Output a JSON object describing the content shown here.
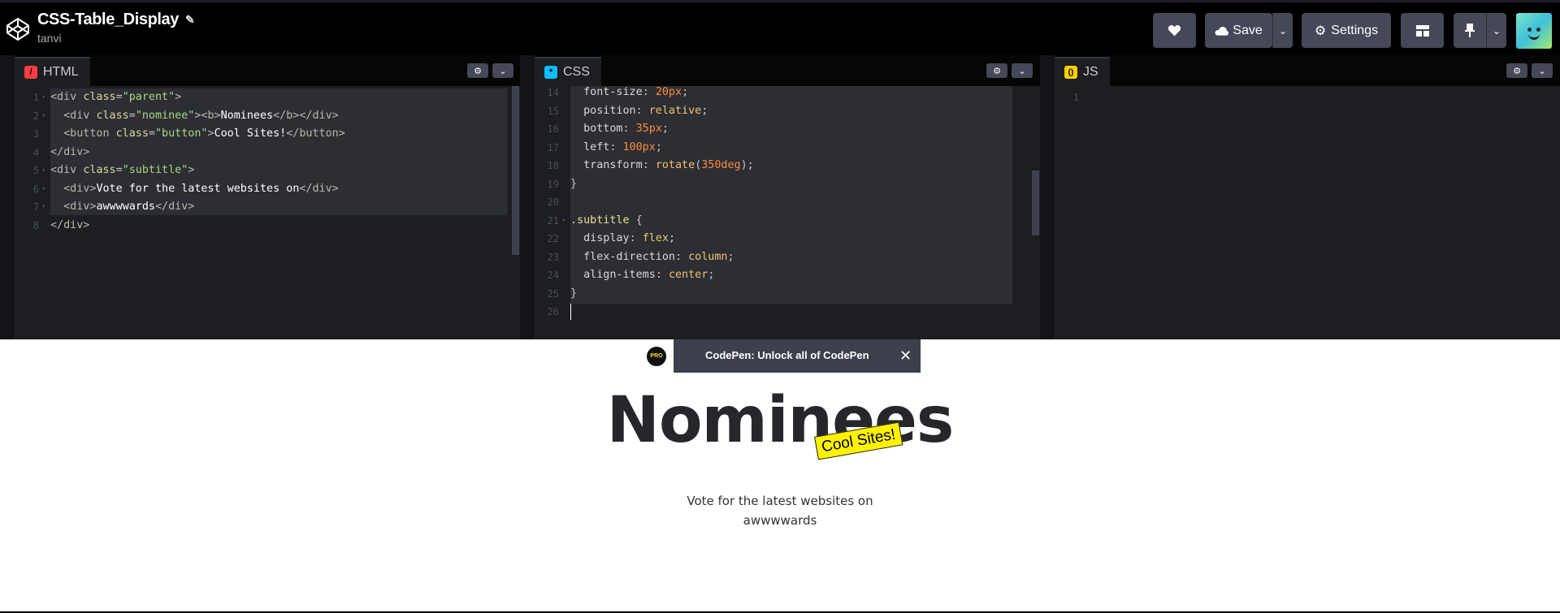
{
  "header": {
    "pen_title": "CSS-Table_Display",
    "author": "tanvi",
    "buttons": {
      "like_icon": "heart-icon",
      "save_label": "Save",
      "settings_label": "Settings",
      "layout_icon": "layout-grid-icon",
      "pin_icon": "pin-icon"
    }
  },
  "editors": {
    "html": {
      "label": "HTML",
      "badge": "/",
      "color": "#ff3c41"
    },
    "css": {
      "label": "CSS",
      "badge": "*",
      "color": "#0ebeff"
    },
    "js": {
      "label": "JS",
      "badge": "()",
      "color": "#fcd000"
    }
  },
  "html_code": {
    "line_numbers": [
      "1",
      "2",
      "3",
      "4",
      "5",
      "6",
      "7",
      "8"
    ]
  },
  "css_code": {
    "line_numbers": [
      "14",
      "15",
      "16",
      "17",
      "18",
      "19",
      "20",
      "21",
      "22",
      "23",
      "24",
      "25",
      "26"
    ]
  },
  "js_code": {
    "line_numbers": [
      "1"
    ]
  },
  "promo": {
    "badge": "PRO",
    "text": "CodePen: Unlock all of CodePen",
    "close": "✕"
  },
  "preview": {
    "heading": "Nominees",
    "button": "Cool Sites!",
    "subtitle_line1": "Vote for the latest websites on",
    "subtitle_line2": "awwwwards"
  }
}
